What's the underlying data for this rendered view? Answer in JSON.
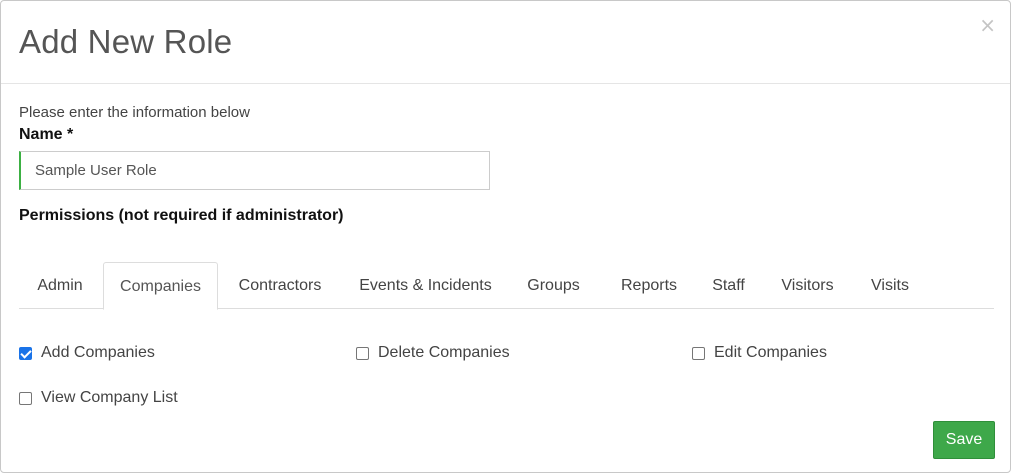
{
  "modal": {
    "title": "Add New Role",
    "close_symbol": "×",
    "intro": "Please enter the information below",
    "name_label": "Name *",
    "name_value": "Sample User Role",
    "permissions_label": "Permissions (not required if administrator)"
  },
  "tabs": [
    {
      "label": "Admin",
      "active": false
    },
    {
      "label": "Companies",
      "active": true
    },
    {
      "label": "Contractors",
      "active": false
    },
    {
      "label": "Events & Incidents",
      "active": false
    },
    {
      "label": "Groups",
      "active": false
    },
    {
      "label": "Reports",
      "active": false
    },
    {
      "label": "Staff",
      "active": false
    },
    {
      "label": "Visitors",
      "active": false
    },
    {
      "label": "Visits",
      "active": false
    }
  ],
  "permissions": [
    {
      "label": "Add Companies",
      "checked": true
    },
    {
      "label": "Delete Companies",
      "checked": false
    },
    {
      "label": "Edit Companies",
      "checked": false
    },
    {
      "label": "View Company List",
      "checked": false
    }
  ],
  "footer": {
    "save_label": "Save"
  },
  "colors": {
    "save_button": "#3ea84a",
    "input_accent": "#3cb043",
    "checkbox_checked": "#1a73e8"
  }
}
